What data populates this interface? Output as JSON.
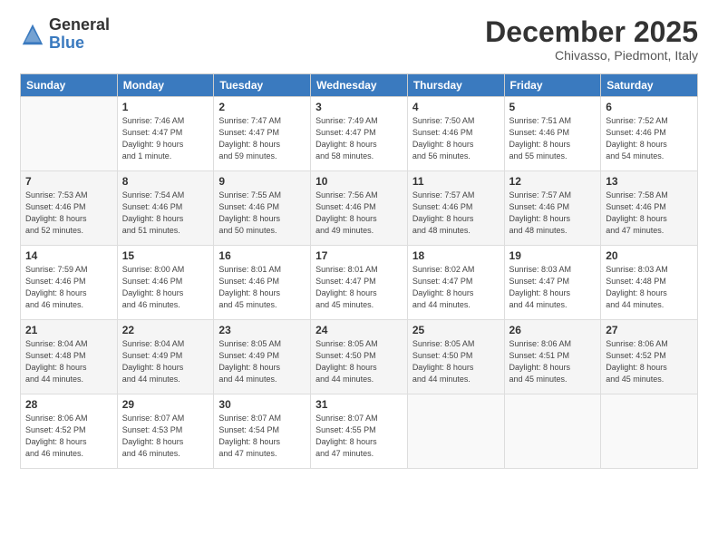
{
  "logo": {
    "general": "General",
    "blue": "Blue"
  },
  "header": {
    "month": "December 2025",
    "location": "Chivasso, Piedmont, Italy"
  },
  "days_of_week": [
    "Sunday",
    "Monday",
    "Tuesday",
    "Wednesday",
    "Thursday",
    "Friday",
    "Saturday"
  ],
  "weeks": [
    [
      {
        "day": "",
        "info": ""
      },
      {
        "day": "1",
        "info": "Sunrise: 7:46 AM\nSunset: 4:47 PM\nDaylight: 9 hours\nand 1 minute."
      },
      {
        "day": "2",
        "info": "Sunrise: 7:47 AM\nSunset: 4:47 PM\nDaylight: 8 hours\nand 59 minutes."
      },
      {
        "day": "3",
        "info": "Sunrise: 7:49 AM\nSunset: 4:47 PM\nDaylight: 8 hours\nand 58 minutes."
      },
      {
        "day": "4",
        "info": "Sunrise: 7:50 AM\nSunset: 4:46 PM\nDaylight: 8 hours\nand 56 minutes."
      },
      {
        "day": "5",
        "info": "Sunrise: 7:51 AM\nSunset: 4:46 PM\nDaylight: 8 hours\nand 55 minutes."
      },
      {
        "day": "6",
        "info": "Sunrise: 7:52 AM\nSunset: 4:46 PM\nDaylight: 8 hours\nand 54 minutes."
      }
    ],
    [
      {
        "day": "7",
        "info": "Sunrise: 7:53 AM\nSunset: 4:46 PM\nDaylight: 8 hours\nand 52 minutes."
      },
      {
        "day": "8",
        "info": "Sunrise: 7:54 AM\nSunset: 4:46 PM\nDaylight: 8 hours\nand 51 minutes."
      },
      {
        "day": "9",
        "info": "Sunrise: 7:55 AM\nSunset: 4:46 PM\nDaylight: 8 hours\nand 50 minutes."
      },
      {
        "day": "10",
        "info": "Sunrise: 7:56 AM\nSunset: 4:46 PM\nDaylight: 8 hours\nand 49 minutes."
      },
      {
        "day": "11",
        "info": "Sunrise: 7:57 AM\nSunset: 4:46 PM\nDaylight: 8 hours\nand 48 minutes."
      },
      {
        "day": "12",
        "info": "Sunrise: 7:57 AM\nSunset: 4:46 PM\nDaylight: 8 hours\nand 48 minutes."
      },
      {
        "day": "13",
        "info": "Sunrise: 7:58 AM\nSunset: 4:46 PM\nDaylight: 8 hours\nand 47 minutes."
      }
    ],
    [
      {
        "day": "14",
        "info": "Sunrise: 7:59 AM\nSunset: 4:46 PM\nDaylight: 8 hours\nand 46 minutes."
      },
      {
        "day": "15",
        "info": "Sunrise: 8:00 AM\nSunset: 4:46 PM\nDaylight: 8 hours\nand 46 minutes."
      },
      {
        "day": "16",
        "info": "Sunrise: 8:01 AM\nSunset: 4:46 PM\nDaylight: 8 hours\nand 45 minutes."
      },
      {
        "day": "17",
        "info": "Sunrise: 8:01 AM\nSunset: 4:47 PM\nDaylight: 8 hours\nand 45 minutes."
      },
      {
        "day": "18",
        "info": "Sunrise: 8:02 AM\nSunset: 4:47 PM\nDaylight: 8 hours\nand 44 minutes."
      },
      {
        "day": "19",
        "info": "Sunrise: 8:03 AM\nSunset: 4:47 PM\nDaylight: 8 hours\nand 44 minutes."
      },
      {
        "day": "20",
        "info": "Sunrise: 8:03 AM\nSunset: 4:48 PM\nDaylight: 8 hours\nand 44 minutes."
      }
    ],
    [
      {
        "day": "21",
        "info": "Sunrise: 8:04 AM\nSunset: 4:48 PM\nDaylight: 8 hours\nand 44 minutes."
      },
      {
        "day": "22",
        "info": "Sunrise: 8:04 AM\nSunset: 4:49 PM\nDaylight: 8 hours\nand 44 minutes."
      },
      {
        "day": "23",
        "info": "Sunrise: 8:05 AM\nSunset: 4:49 PM\nDaylight: 8 hours\nand 44 minutes."
      },
      {
        "day": "24",
        "info": "Sunrise: 8:05 AM\nSunset: 4:50 PM\nDaylight: 8 hours\nand 44 minutes."
      },
      {
        "day": "25",
        "info": "Sunrise: 8:05 AM\nSunset: 4:50 PM\nDaylight: 8 hours\nand 44 minutes."
      },
      {
        "day": "26",
        "info": "Sunrise: 8:06 AM\nSunset: 4:51 PM\nDaylight: 8 hours\nand 45 minutes."
      },
      {
        "day": "27",
        "info": "Sunrise: 8:06 AM\nSunset: 4:52 PM\nDaylight: 8 hours\nand 45 minutes."
      }
    ],
    [
      {
        "day": "28",
        "info": "Sunrise: 8:06 AM\nSunset: 4:52 PM\nDaylight: 8 hours\nand 46 minutes."
      },
      {
        "day": "29",
        "info": "Sunrise: 8:07 AM\nSunset: 4:53 PM\nDaylight: 8 hours\nand 46 minutes."
      },
      {
        "day": "30",
        "info": "Sunrise: 8:07 AM\nSunset: 4:54 PM\nDaylight: 8 hours\nand 47 minutes."
      },
      {
        "day": "31",
        "info": "Sunrise: 8:07 AM\nSunset: 4:55 PM\nDaylight: 8 hours\nand 47 minutes."
      },
      {
        "day": "",
        "info": ""
      },
      {
        "day": "",
        "info": ""
      },
      {
        "day": "",
        "info": ""
      }
    ]
  ]
}
